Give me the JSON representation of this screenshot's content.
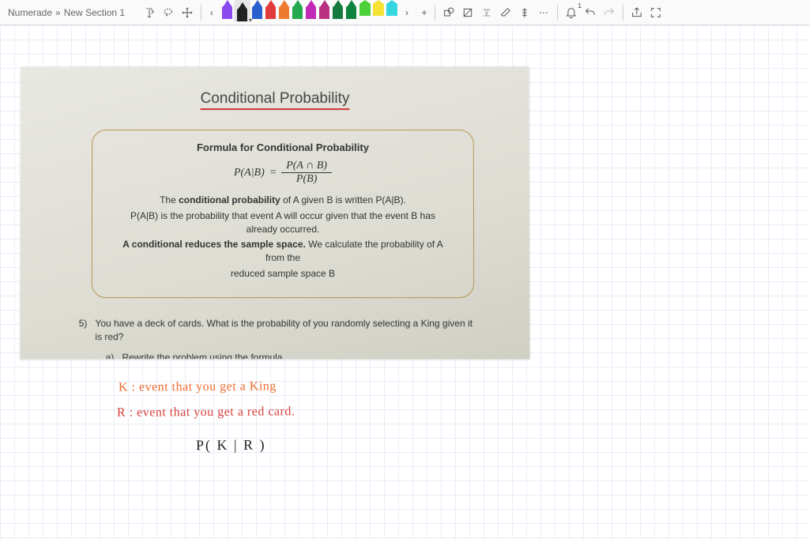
{
  "breadcrumb": {
    "root": "Numerade",
    "separator": "»",
    "section": "New Section 1"
  },
  "toolbar": {
    "text_tool": "Text",
    "lasso_tool": "Lasso",
    "pan_tool": "Pan",
    "scroll_left": "‹",
    "scroll_right": "›",
    "add_pen": "+",
    "shape_tool": "Shapes",
    "ink_to_shape": "Ink to Shape",
    "ink_to_math": "Ink to Math",
    "eraser": "Eraser",
    "ruler": "Ruler",
    "more": "⋯",
    "notifications": "Notifications",
    "notif_count": "1",
    "undo": "Undo",
    "redo": "Redo",
    "share": "Share",
    "fullscreen": "Enter Full Screen"
  },
  "pens": [
    {
      "color": "#8b4af0",
      "type": "pen"
    },
    {
      "color": "#222222",
      "type": "pen",
      "selected": true
    },
    {
      "color": "#2a5fd0",
      "type": "pen"
    },
    {
      "color": "#e23b3b",
      "type": "pen"
    },
    {
      "color": "#ee7b2d",
      "type": "pen"
    },
    {
      "color": "#23a850",
      "type": "pen"
    },
    {
      "color": "#c12ab7",
      "type": "pen"
    },
    {
      "color": "#b93080",
      "type": "pen"
    },
    {
      "color": "#147a3e",
      "type": "pen"
    },
    {
      "color": "#0e833e",
      "type": "pen"
    },
    {
      "color": "#4cd038",
      "type": "highlighter"
    },
    {
      "color": "#f5e233",
      "type": "highlighter"
    },
    {
      "color": "#34d6e0",
      "type": "highlighter"
    }
  ],
  "slide": {
    "title": "Conditional Probability",
    "box_title": "Formula for Conditional Probability",
    "formula_lhs": "P(A|B)",
    "formula_eq": "=",
    "formula_num": "P(A ∩ B)",
    "formula_den": "P(B)",
    "line1_pre": "The ",
    "line1_bold": "conditional probability",
    "line1_post": " of A given B is written P(A|B).",
    "line2": "P(A|B) is the probability that event A will occur given that the event B has already occurred.",
    "line3_bold": "A conditional reduces the sample space.",
    "line3_post": " We calculate the probability of A from the",
    "line4": "reduced sample space B",
    "q_num": "5)",
    "q_text": "You have a deck of cards. What is the probability of you randomly selecting a King given it is red?",
    "qa_label": "a)",
    "qa_text": "Rewrite the problem using the formula"
  },
  "handwriting": {
    "k_line": "K :   event  that    you   get  a  King",
    "r_line": "R :   event  that   you   get   a  red  card.",
    "pkr": "P( K | R )"
  }
}
